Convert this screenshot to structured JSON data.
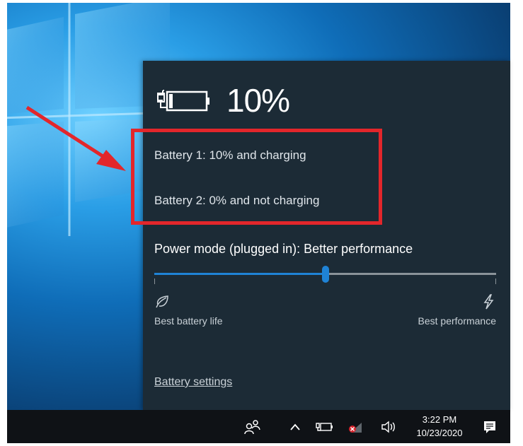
{
  "battery": {
    "percent": "10%",
    "battery1_status": "Battery 1: 10% and charging",
    "battery2_status": "Battery 2: 0% and not charging",
    "level_fraction": 0.1
  },
  "power_mode": {
    "label": "Power mode (plugged in): Better performance",
    "slider_fraction": 0.5,
    "left_label": "Best battery life",
    "right_label": "Best performance",
    "left_icon": "leaf-icon",
    "right_icon": "bolt-icon"
  },
  "links": {
    "battery_settings": "Battery settings"
  },
  "taskbar": {
    "time": "3:22 PM",
    "date": "10/23/2020",
    "icons": [
      "people-icon",
      "chevron-up-icon",
      "battery-icon",
      "network-disconnected-icon",
      "volume-icon",
      "notification-icon"
    ]
  },
  "colors": {
    "flyout_bg": "#1c2b36",
    "accent": "#1f83d6",
    "annotation_red": "#e3262b",
    "taskbar_bg": "#0f1216"
  }
}
